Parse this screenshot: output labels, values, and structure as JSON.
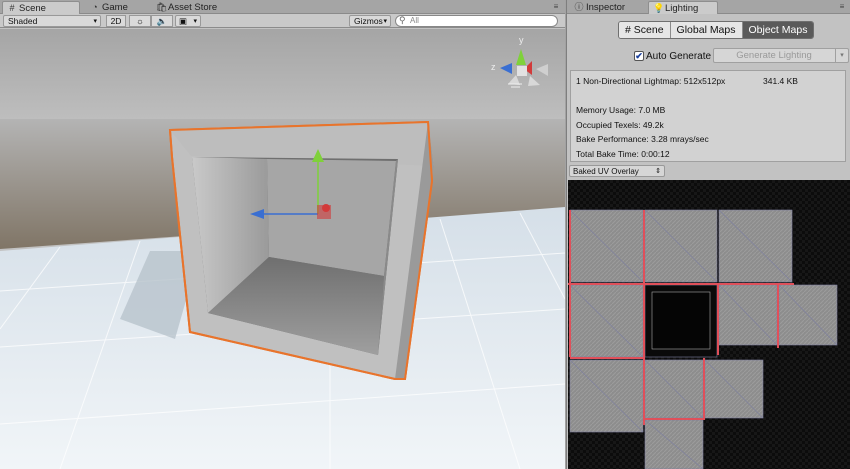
{
  "scene_window": {
    "tabs": [
      {
        "label": "Scene",
        "icon": "grid-icon",
        "active": true
      },
      {
        "label": "Game",
        "icon": "pacman-icon",
        "active": false
      },
      {
        "label": "Asset Store",
        "icon": "store-icon",
        "active": false
      }
    ],
    "toolbar": {
      "shading_mode": "Shaded",
      "mode_2d": "2D",
      "lighting_toggle_icon": "sun-icon",
      "audio_toggle_icon": "speaker-icon",
      "effects_toggle_icon": "image-icon",
      "gizmos_label": "Gizmos",
      "search_placeholder": "All"
    },
    "orientation_gizmo": {
      "y_label": "y",
      "z_label": "z"
    },
    "colors": {
      "selection_outline": "#e8742c",
      "axis_x": "#d23a3a",
      "axis_y": "#7fd13a",
      "axis_z": "#3a6fd2"
    }
  },
  "right_window": {
    "tabs": [
      {
        "label": "Inspector",
        "icon": "info-icon",
        "active": false
      },
      {
        "label": "Lighting",
        "icon": "lightbulb-icon",
        "active": true
      }
    ],
    "mode_tabs": [
      {
        "label": "Scene",
        "icon": "grid-icon",
        "selected": false
      },
      {
        "label": "Global Maps",
        "selected": false
      },
      {
        "label": "Object Maps",
        "selected": true
      }
    ],
    "auto_generate": {
      "label": "Auto Generate",
      "checked": true,
      "check_glyph": "✔"
    },
    "generate_button": "Generate Lighting",
    "info": {
      "lightmap_line": "1 Non-Directional Lightmap: 512x512px",
      "lightmap_size": "341.4 KB",
      "memory_usage": "Memory Usage: 7.0 MB",
      "occupied_texels": "Occupied Texels: 49.2k",
      "bake_performance": "Bake Performance: 3.28 mrays/sec",
      "total_bake_time": "Total Bake Time: 0:00:12"
    },
    "uv_overlay_dropdown": "Baked UV Overlay"
  }
}
